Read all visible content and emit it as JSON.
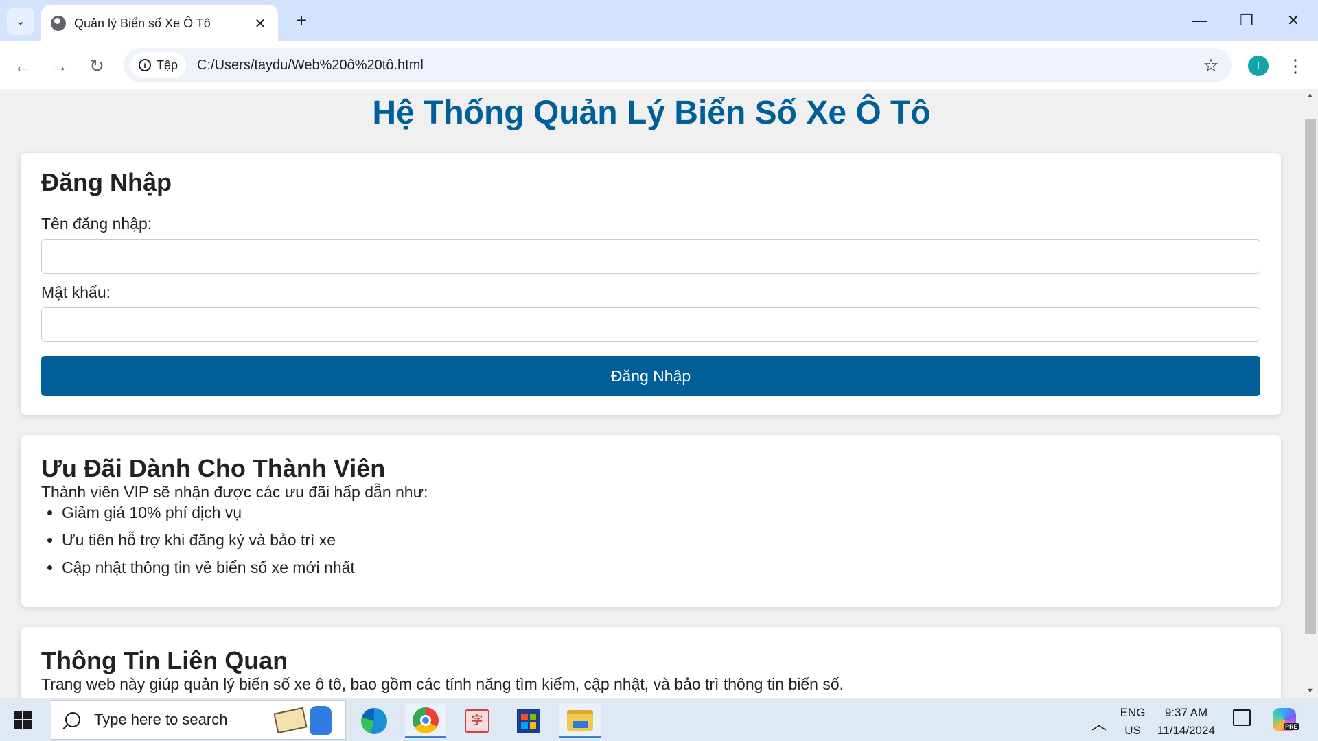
{
  "browser": {
    "tab_title": "Quản lý Biển số Xe Ô Tô",
    "site_chip": "Tệp",
    "url": "C:/Users/taydu/Web%20ô%20tô.html",
    "profile_initial": "I"
  },
  "page": {
    "title": "Hệ Thống Quản Lý Biển Số Xe Ô Tô",
    "login": {
      "heading": "Đăng Nhập",
      "username_label": "Tên đăng nhập:",
      "username_value": "",
      "password_label": "Mật khẩu:",
      "password_value": "",
      "submit_label": "Đăng Nhập"
    },
    "member": {
      "heading": "Ưu Đãi Dành Cho Thành Viên",
      "intro": "Thành viên VIP sẽ nhận được các ưu đãi hấp dẫn như:",
      "benefits": [
        "Giảm giá 10% phí dịch vụ",
        "Ưu tiên hỗ trợ khi đăng ký và bảo trì xe",
        "Cập nhật thông tin về biển số xe mới nhất"
      ]
    },
    "info": {
      "heading": "Thông Tin Liên Quan",
      "text": "Trang web này giúp quản lý biển số xe ô tô, bao gồm các tính năng tìm kiếm, cập nhật, và bảo trì thông tin biển số."
    }
  },
  "taskbar": {
    "search_placeholder": "Type here to search",
    "lang_line1": "ENG",
    "lang_line2": "US",
    "time": "9:37 AM",
    "date": "11/14/2024",
    "copilot_badge": "PRE"
  },
  "colors": {
    "primary": "#005e99",
    "tabbar": "#d3e3fd",
    "page_bg": "#f0f0f0"
  }
}
